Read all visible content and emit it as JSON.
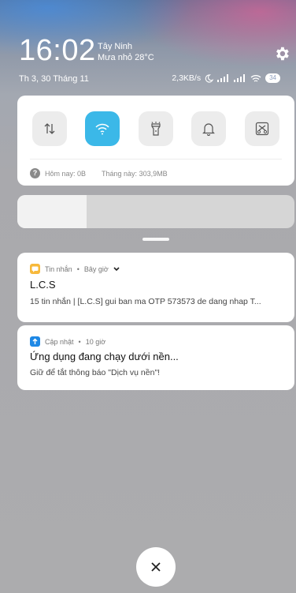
{
  "status_bar": {
    "time": "16:02",
    "location": "Tây Ninh",
    "weather": "Mưa nhỏ 28°C",
    "date": "Th 3, 30 Tháng 11",
    "network_speed": "2,3KB/s",
    "battery": "34"
  },
  "quick_settings": {
    "tiles": [
      {
        "name": "mobile-data",
        "icon": "arrows-updown-icon",
        "active": false
      },
      {
        "name": "wifi",
        "icon": "wifi-icon",
        "active": true
      },
      {
        "name": "flashlight",
        "icon": "flashlight-icon",
        "active": false
      },
      {
        "name": "ring",
        "icon": "bell-icon",
        "active": false
      },
      {
        "name": "screenshot",
        "icon": "scissors-icon",
        "active": false
      }
    ],
    "usage_today": "Hôm nay: 0B",
    "usage_month": "Tháng này: 303,9MB"
  },
  "brightness": {
    "level": 0.25
  },
  "notifications": [
    {
      "app": "Tin nhắn",
      "time": "Bây giờ",
      "title": "L.C.S",
      "body": "15 tin nhắn | [L.C.S] gui ban ma OTP 573573 de dang nhap T...",
      "icon": "message-icon",
      "icon_color": "#f7b93b"
    },
    {
      "app": "Cập nhật",
      "time": "10 giờ",
      "title": "Ứng dụng đang chạy dưới nền...",
      "body": "Giữ để tắt thông báo \"Dịch vụ nền\"!",
      "icon": "update-arrow-icon",
      "icon_color": "#1e88e5"
    }
  ],
  "colors": {
    "accent": "#3bb8e8"
  }
}
